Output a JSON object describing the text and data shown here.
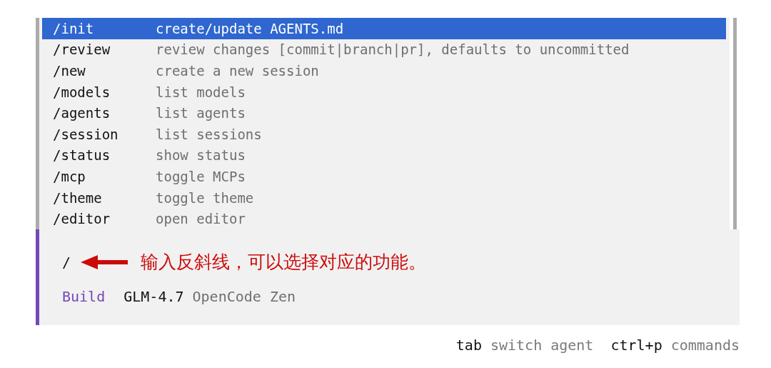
{
  "menu": {
    "items": [
      {
        "command": "/init",
        "description": "create/update AGENTS.md",
        "selected": true
      },
      {
        "command": "/review",
        "description": "review changes [commit|branch|pr], defaults to uncommitted",
        "selected": false
      },
      {
        "command": "/new",
        "description": "create a new session",
        "selected": false
      },
      {
        "command": "/models",
        "description": "list models",
        "selected": false
      },
      {
        "command": "/agents",
        "description": "list agents",
        "selected": false
      },
      {
        "command": "/session",
        "description": "list sessions",
        "selected": false
      },
      {
        "command": "/status",
        "description": "show status",
        "selected": false
      },
      {
        "command": "/mcp",
        "description": "toggle MCPs",
        "selected": false
      },
      {
        "command": "/theme",
        "description": "toggle theme",
        "selected": false
      },
      {
        "command": "/editor",
        "description": "open editor",
        "selected": false
      }
    ]
  },
  "input": {
    "value": "/",
    "annotation": "输入反斜线，可以选择对应的功能。"
  },
  "status": {
    "agent": "Build",
    "model": "GLM-4.7",
    "provider": "OpenCode Zen"
  },
  "hints": [
    {
      "key": "tab",
      "label": "switch agent"
    },
    {
      "key": "ctrl+p",
      "label": "commands"
    }
  ]
}
